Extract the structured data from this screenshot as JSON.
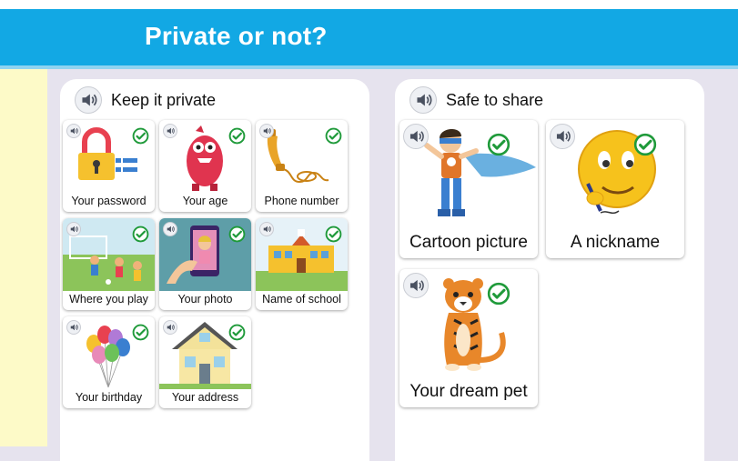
{
  "header": {
    "title": "Private or not?"
  },
  "panels": [
    {
      "title": "Keep it private"
    },
    {
      "title": "Safe to share"
    }
  ],
  "private_items": [
    {
      "label": "Your password",
      "icon": "padlock-icon"
    },
    {
      "label": "Your age",
      "icon": "monster-icon"
    },
    {
      "label": "Phone number",
      "icon": "telephone-icon"
    },
    {
      "label": "Where you play",
      "icon": "playground-icon"
    },
    {
      "label": "Your photo",
      "icon": "phone-photo-icon"
    },
    {
      "label": "Name of school",
      "icon": "school-icon"
    },
    {
      "label": "Your birthday",
      "icon": "balloons-icon"
    },
    {
      "label": "Your address",
      "icon": "house-icon"
    }
  ],
  "share_items": [
    {
      "label": "Cartoon picture",
      "icon": "superhero-icon"
    },
    {
      "label": "A nickname",
      "icon": "emoji-writing-icon"
    },
    {
      "label": "Your dream pet",
      "icon": "tiger-icon"
    }
  ],
  "colors": {
    "header": "#12a8e4",
    "check": "#1f9a3a",
    "left_bar": "#fdfac8",
    "background": "#e6e3ee"
  }
}
